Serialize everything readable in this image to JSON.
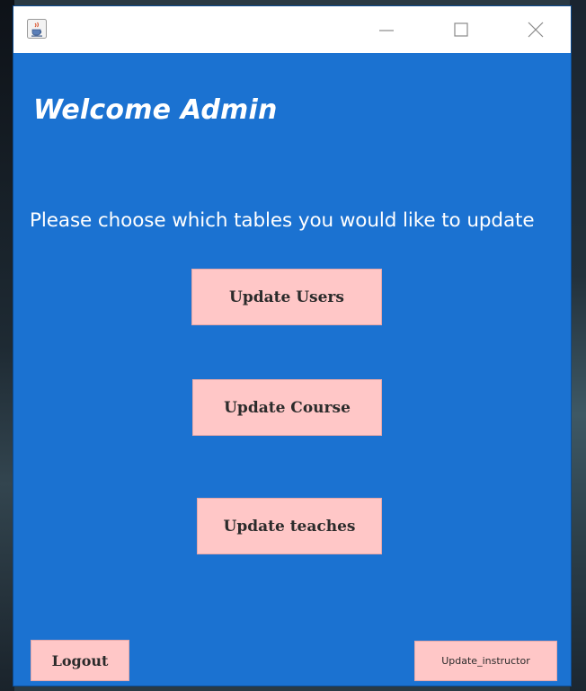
{
  "window": {
    "title": "",
    "app_icon": "java-coffee-icon",
    "controls": {
      "minimize_icon": "minimize-icon",
      "maximize_icon": "maximize-icon",
      "close_icon": "close-icon"
    }
  },
  "main": {
    "welcome": "Welcome Admin",
    "prompt": "Please choose which tables you would like to update",
    "buttons": {
      "update_users": "Update Users",
      "update_course": "Update Course",
      "update_teaches": "Update teaches",
      "logout": "Logout",
      "update_instructor": "Update_instructor"
    }
  },
  "colors": {
    "background": "#1b72d1",
    "button": "#ffc7c7",
    "text": "#ffffff"
  }
}
